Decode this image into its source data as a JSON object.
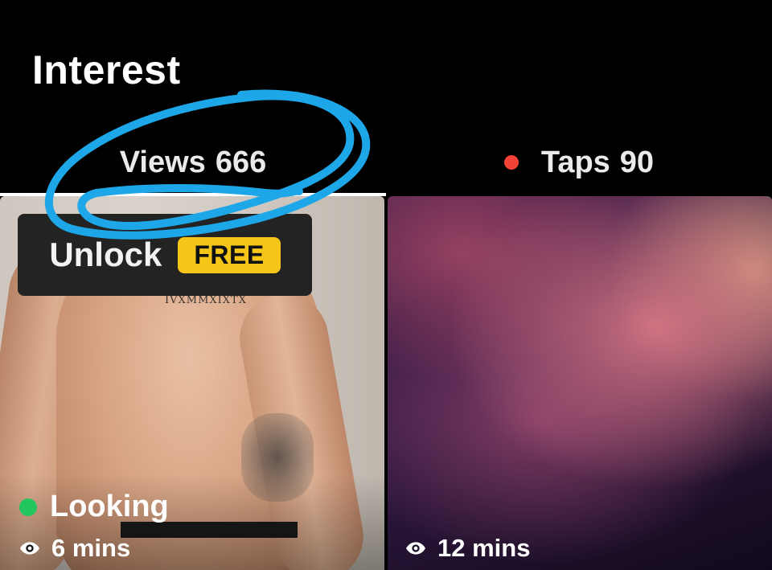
{
  "header": {
    "title": "Interest"
  },
  "tabs": [
    {
      "label": "Views",
      "count": "666",
      "selected": true
    },
    {
      "label": "Taps",
      "count": "90",
      "selected": false,
      "unread_dot_color": "#f44336"
    }
  ],
  "cards": [
    {
      "unlock_label": "Unlock",
      "free_label": "FREE",
      "chest_text": "IVXMMXIXTX",
      "status": "Looking",
      "status_color": "#22c55e",
      "time": "6 mins",
      "time_icon": "eye-icon"
    },
    {
      "time": "12 mins",
      "time_icon": "eye-icon",
      "blurred": true
    }
  ],
  "colors": {
    "background": "#000000",
    "free_badge": "#f5c518",
    "annotation": "#1ea7e8"
  }
}
